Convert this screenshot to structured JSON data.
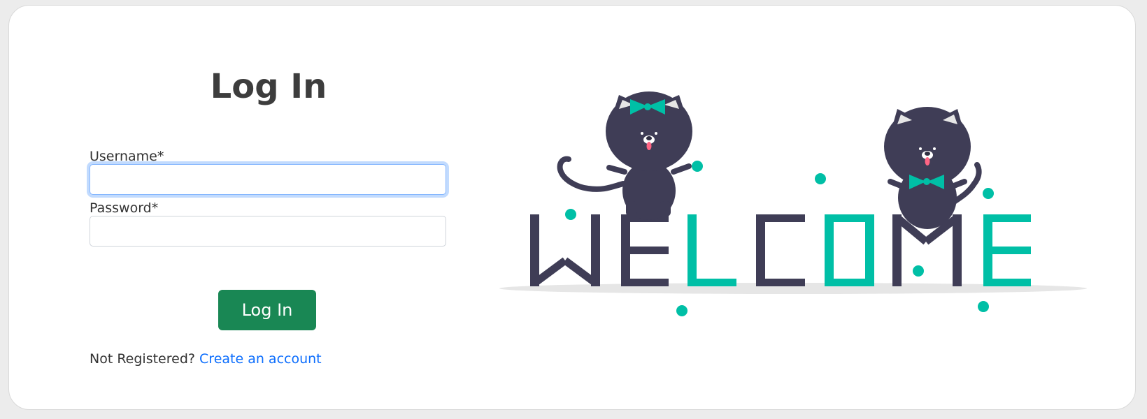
{
  "login_form": {
    "title": "Log In",
    "username_label": "Username*",
    "username_value": "",
    "password_label": "Password*",
    "password_value": "",
    "submit_label": "Log In",
    "register_prompt": "Not Registered?",
    "register_link": "Create an account"
  },
  "illustration": {
    "subject": "welcome-cats",
    "letters": [
      {
        "char": "W",
        "color": "#3f3d56"
      },
      {
        "char": "E",
        "color": "#3f3d56"
      },
      {
        "char": "L",
        "color": "#00bfa6"
      },
      {
        "char": "C",
        "color": "#3f3d56"
      },
      {
        "char": "O",
        "color": "#00bfa6"
      },
      {
        "char": "M",
        "color": "#3f3d56"
      },
      {
        "char": "E",
        "color": "#00bfa6"
      }
    ]
  },
  "colors": {
    "accent": "#00bfa6",
    "dark": "#3f3d56",
    "button": "#198754",
    "link": "#0d6efd"
  }
}
